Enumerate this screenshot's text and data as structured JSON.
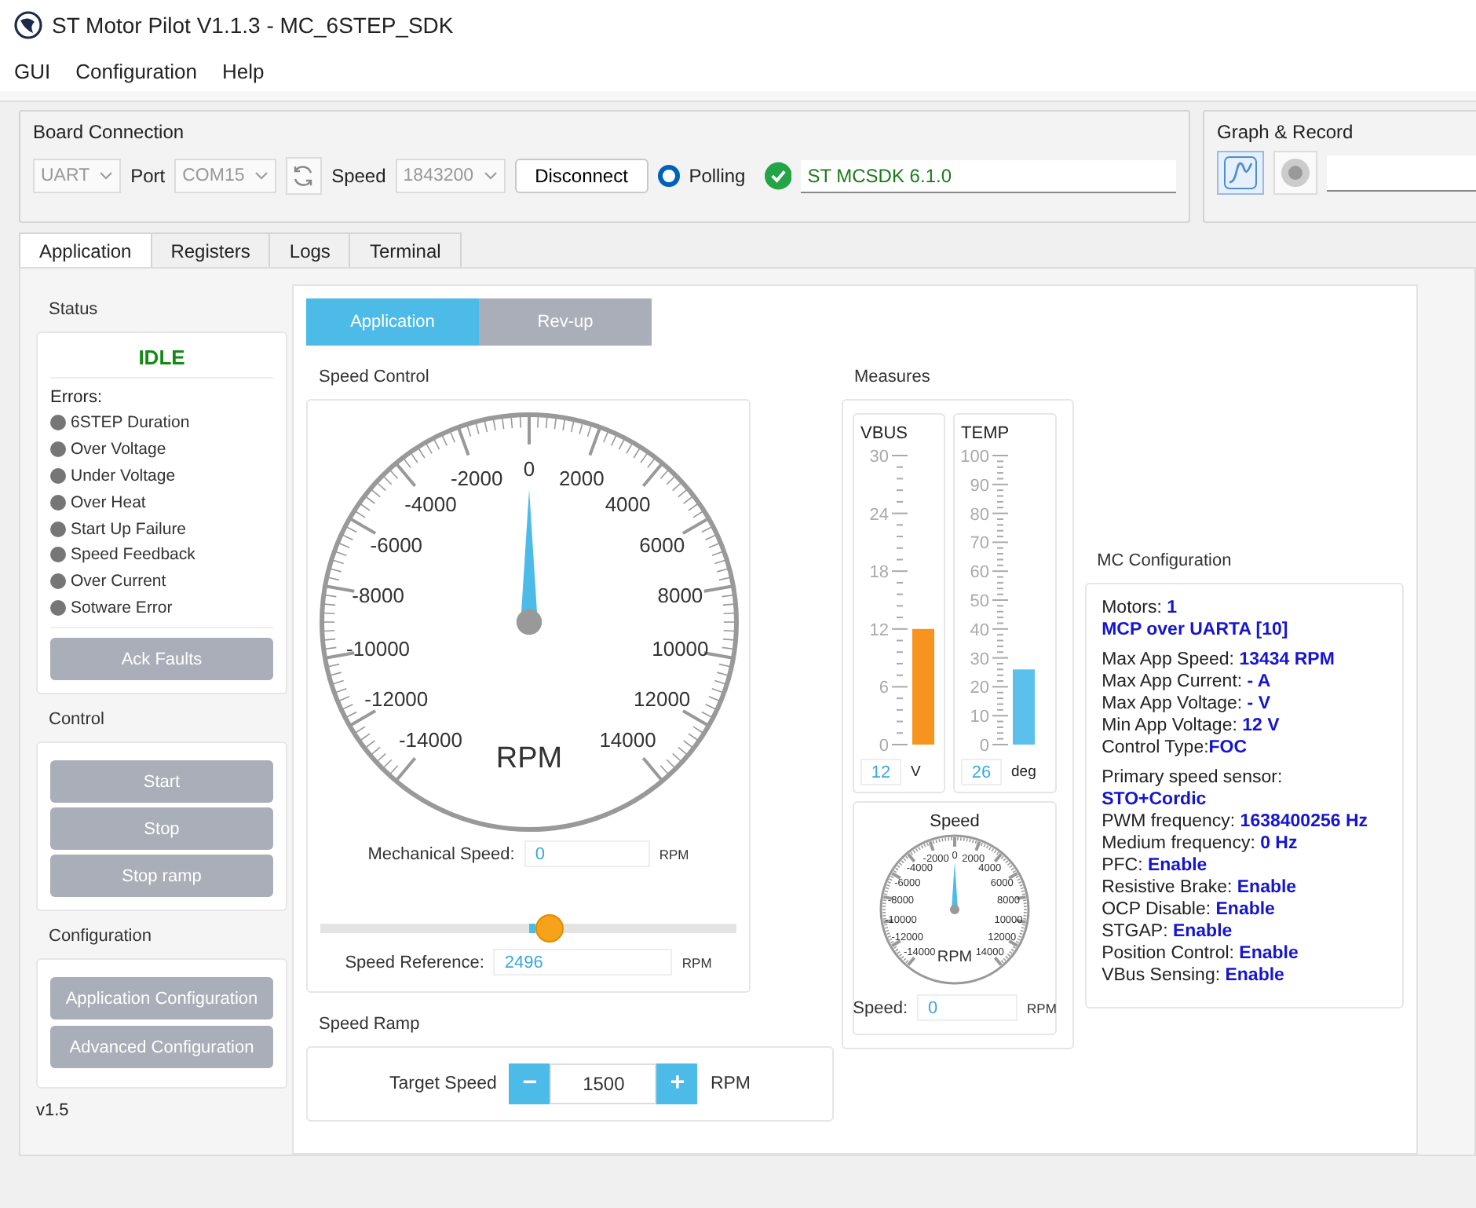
{
  "window": {
    "title": "ST Motor Pilot V1.1.3 - MC_6STEP_SDK"
  },
  "menu": [
    "GUI",
    "Configuration",
    "Help"
  ],
  "board_connection": {
    "title": "Board Connection",
    "interface": {
      "value": "UART",
      "disabled": true
    },
    "port_label": "Port",
    "port": {
      "value": "COM15",
      "disabled": true
    },
    "speed_label": "Speed",
    "speed": {
      "value": "1843200",
      "disabled": true
    },
    "connect_button": "Disconnect",
    "polling": {
      "label": "Polling",
      "selected": true
    },
    "connected": true,
    "firmware": "ST MCSDK 6.1.0"
  },
  "graph_record": {
    "title": "Graph & Record"
  },
  "tabs": [
    {
      "label": "Application",
      "selected": true
    },
    {
      "label": "Registers",
      "selected": false
    },
    {
      "label": "Logs",
      "selected": false
    },
    {
      "label": "Terminal",
      "selected": false
    }
  ],
  "status": {
    "title": "Status",
    "state": "IDLE",
    "errors_label": "Errors:",
    "errors": [
      {
        "label": "6STEP Duration",
        "active": false
      },
      {
        "label": "Over Voltage",
        "active": false
      },
      {
        "label": "Under Voltage",
        "active": false
      },
      {
        "label": "Over Heat",
        "active": false
      },
      {
        "label": "Start Up Failure",
        "active": false
      },
      {
        "label": "Speed Feedback",
        "active": false
      },
      {
        "label": "Over Current",
        "active": false
      },
      {
        "label": "Sotware Error",
        "active": false
      }
    ],
    "ack_button": {
      "label": "Ack Faults",
      "disabled": true
    }
  },
  "control": {
    "title": "Control",
    "buttons": [
      {
        "label": "Start",
        "disabled": true
      },
      {
        "label": "Stop",
        "disabled": true
      },
      {
        "label": "Stop ramp",
        "disabled": true
      }
    ]
  },
  "configuration": {
    "title": "Configuration",
    "buttons": [
      {
        "label": "Application Configuration",
        "disabled": true
      },
      {
        "label": "Advanced Configuration",
        "disabled": true
      }
    ]
  },
  "version": "v1.5",
  "subtabs": [
    {
      "label": "Application",
      "selected": true
    },
    {
      "label": "Rev-up",
      "selected": false
    }
  ],
  "speed_control": {
    "title": "Speed Control",
    "gauge": {
      "scale_labels": [
        "0",
        "-2000",
        "2000",
        "-4000",
        "4000",
        "-6000",
        "6000",
        "-8000",
        "8000",
        "-10000",
        "10000",
        "-12000",
        "12000",
        "-14000",
        "14000"
      ],
      "unit": "RPM",
      "level": 0.5
    },
    "mechanical_speed": {
      "label": "Mechanical Speed:",
      "value": "0",
      "unit": "RPM"
    },
    "slider": {
      "level": 0.55
    },
    "speed_reference": {
      "label": "Speed Reference:",
      "value": "2496",
      "unit": "RPM"
    }
  },
  "speed_ramp": {
    "title": "Speed Ramp",
    "target_speed": {
      "label": "Target Speed",
      "decrement": "−",
      "value": "1500",
      "increment": "+",
      "unit": "RPM"
    }
  },
  "measures": {
    "title": "Measures",
    "meters": [
      {
        "title": "VBUS",
        "scale_labels": [
          "30",
          "24",
          "18",
          "12",
          "6",
          "0"
        ],
        "level": 0.4,
        "color": "#f7941d",
        "value": "12",
        "unit": "V"
      },
      {
        "title": "TEMP",
        "scale_labels": [
          "100",
          "90",
          "80",
          "70",
          "60",
          "50",
          "40",
          "30",
          "20",
          "10",
          "0"
        ],
        "level": 0.26,
        "color": "#5bc0eb",
        "value": "26",
        "unit": "deg"
      }
    ],
    "speed": {
      "title": "Speed",
      "gauge": {
        "scale_labels": [
          "0",
          "-2000",
          "2000",
          "-4000",
          "4000",
          "-6000",
          "6000",
          "-8000",
          "8000",
          "-10000",
          "10000",
          "-12000",
          "12000",
          "-14000",
          "14000"
        ],
        "unit": "RPM",
        "level": 0.5
      },
      "label": "Speed:",
      "value": "0",
      "unit": "RPM"
    }
  },
  "mc_configuration": {
    "title": "MC Configuration",
    "groups": [
      [
        {
          "text": "Motors: **1**",
          "bold": false
        },
        {
          "text": "MCP over UARTA [10]",
          "bold": true
        }
      ],
      [
        {
          "text": "Max App Speed: **13434 RPM**",
          "bold": false
        },
        {
          "text": "Max App Current: **- A**",
          "bold": false
        },
        {
          "text": "Max App Voltage: **- V**",
          "bold": false
        },
        {
          "text": "Min App Voltage: **12 V**",
          "bold": false
        },
        {
          "text": "Control Type:**FOC**",
          "bold": false
        }
      ],
      [
        {
          "text": "Primary speed sensor: **STO+Cordic**",
          "bold": false
        },
        {
          "text": "PWM frequency: **1638400256 Hz**",
          "bold": false
        },
        {
          "text": "Medium frequency: **0 Hz**",
          "bold": false
        },
        {
          "text": "PFC: **Enable**",
          "bold": false
        },
        {
          "text": "Resistive Brake: **Enable**",
          "bold": false
        },
        {
          "text": "OCP Disable: **Enable**",
          "bold": false
        },
        {
          "text": "STGAP: **Enable**",
          "bold": false
        },
        {
          "text": "Position Control: **Enable**",
          "bold": false
        },
        {
          "text": "VBus Sensing: **Enable**",
          "bold": false
        }
      ]
    ]
  }
}
